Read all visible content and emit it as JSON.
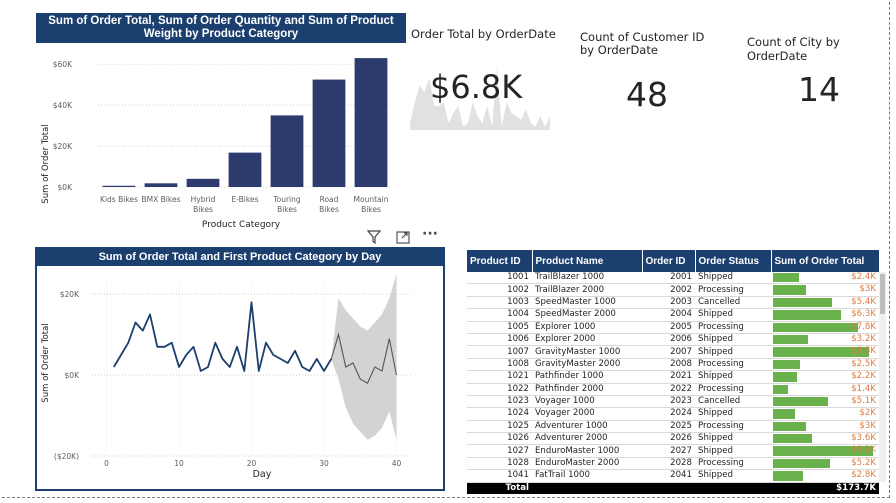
{
  "bar_chart": {
    "title": "Sum of Order Total, Sum of Order Quantity and Sum of Product Weight by Product Category",
    "ylabel": "Sum of Order Total",
    "xlabel": "Product Category",
    "yticks": [
      "$60K",
      "$40K",
      "$20K",
      "$0K"
    ],
    "categories": [
      "Kids Bikes",
      "BMX Bikes",
      "Hybrid\nBikes",
      "E-Bikes",
      "Touring\nBikes",
      "Road\nBikes",
      "Mountain\nBikes"
    ],
    "bar_color": "#2d3a6e"
  },
  "kpis": [
    {
      "title": "Order Total by OrderDate",
      "value": "$6.8K"
    },
    {
      "title": "Count of Customer ID by OrderDate",
      "value": "48"
    },
    {
      "title": "Count of City by OrderDate",
      "value": "14"
    }
  ],
  "line_chart": {
    "title": "Sum of Order Total and First Product Category by Day",
    "ylabel": "Sum of Order Total",
    "xlabel": "Day",
    "yticks": [
      "$20K",
      "$0K",
      "($20K)"
    ],
    "xticks": [
      "0",
      "10",
      "20",
      "30",
      "40"
    ],
    "line_color": "#1b3f6e",
    "forecast_color": "#555555",
    "band_color": "#d3d3d3"
  },
  "visual_toolbar": {
    "filter_icon": "filter-icon",
    "focus_icon": "focus-mode-icon",
    "more_icon": "more-options-icon",
    "more_label": "···"
  },
  "table": {
    "columns": [
      "Product ID",
      "Product Name",
      "Order ID",
      "Order Status",
      "Sum of Order Total"
    ],
    "rows": [
      [
        "1001",
        "TrailBlazer 1000",
        "2001",
        "Shipped",
        "$2.4K"
      ],
      [
        "1002",
        "TrailBlazer 2000",
        "2002",
        "Processing",
        "$3K"
      ],
      [
        "1003",
        "SpeedMaster 1000",
        "2003",
        "Cancelled",
        "$5.4K"
      ],
      [
        "1004",
        "SpeedMaster 2000",
        "2004",
        "Shipped",
        "$6.3K"
      ],
      [
        "1005",
        "Explorer 1000",
        "2005",
        "Processing",
        "$7.8K"
      ],
      [
        "1006",
        "Explorer 2000",
        "2006",
        "Shipped",
        "$3.2K"
      ],
      [
        "1007",
        "GravityMaster 1000",
        "2007",
        "Shipped",
        "$8.8K"
      ],
      [
        "1008",
        "GravityMaster 2000",
        "2008",
        "Processing",
        "$2.5K"
      ],
      [
        "1021",
        "Pathfinder 1000",
        "2021",
        "Shipped",
        "$2.2K"
      ],
      [
        "1022",
        "Pathfinder 2000",
        "2022",
        "Processing",
        "$1.4K"
      ],
      [
        "1023",
        "Voyager 1000",
        "2023",
        "Cancelled",
        "$5.1K"
      ],
      [
        "1024",
        "Voyager 2000",
        "2024",
        "Shipped",
        "$2K"
      ],
      [
        "1025",
        "Adventurer 1000",
        "2025",
        "Processing",
        "$3K"
      ],
      [
        "1026",
        "Adventurer 2000",
        "2026",
        "Shipped",
        "$3.6K"
      ],
      [
        "1027",
        "EnduroMaster 1000",
        "2027",
        "Shipped",
        "$9.2K"
      ],
      [
        "1028",
        "EnduroMaster 2000",
        "2028",
        "Processing",
        "$5.2K"
      ],
      [
        "1041",
        "FatTrail 1000",
        "2041",
        "Shipped",
        "$2.8K"
      ]
    ],
    "total_label": "Total",
    "total_value": "$173.7K",
    "bar_color": "#6ab04c",
    "value_color": "#e07b3c"
  },
  "chart_data": [
    {
      "type": "bar",
      "title": "Sum of Order Total, Sum of Order Quantity and Sum of Product Weight by Product Category",
      "categories": [
        "Kids Bikes",
        "BMX Bikes",
        "Hybrid Bikes",
        "E-Bikes",
        "Touring Bikes",
        "Road Bikes",
        "Mountain Bikes"
      ],
      "values": [
        600,
        1800,
        4000,
        16800,
        35000,
        52500,
        63000
      ],
      "xlabel": "Product Category",
      "ylabel": "Sum of Order Total",
      "ylim": [
        0,
        65000
      ]
    },
    {
      "type": "line",
      "title": "Sum of Order Total and First Product Category by Day",
      "xlabel": "Day",
      "ylabel": "Sum of Order Total",
      "xlim": [
        -2,
        42
      ],
      "ylim": [
        -20000,
        24000
      ],
      "series": [
        {
          "x": [
            1,
            3,
            4,
            5,
            6,
            7,
            8,
            9,
            10,
            11,
            12,
            13,
            14,
            15,
            16,
            17,
            18,
            19,
            20,
            21,
            22,
            23,
            24,
            25,
            26,
            27,
            28,
            29,
            30,
            31
          ],
          "values": [
            2000,
            8000,
            13000,
            11000,
            15000,
            7000,
            7000,
            8000,
            2000,
            5000,
            7000,
            1000,
            2000,
            8000,
            4000,
            2000,
            7000,
            1000,
            18000,
            1000,
            8000,
            5000,
            4000,
            3000,
            6000,
            2000,
            1000,
            4000,
            1000,
            4000
          ]
        },
        {
          "x": [
            31,
            32,
            33,
            34,
            35,
            36,
            37,
            38,
            39,
            40
          ],
          "values": [
            4000,
            10000,
            2000,
            3000,
            -1000,
            -2000,
            2000,
            1000,
            9000,
            0
          ]
        }
      ],
      "forecast_band": {
        "x": [
          32,
          33,
          34,
          35,
          36,
          37,
          38,
          39,
          40
        ],
        "upper": [
          19000,
          16000,
          14000,
          12000,
          11000,
          13000,
          15000,
          19000,
          25000
        ],
        "lower": [
          -1000,
          -8000,
          -12000,
          -14000,
          -16000,
          -15000,
          -13000,
          -9000,
          -16000
        ]
      }
    }
  ]
}
